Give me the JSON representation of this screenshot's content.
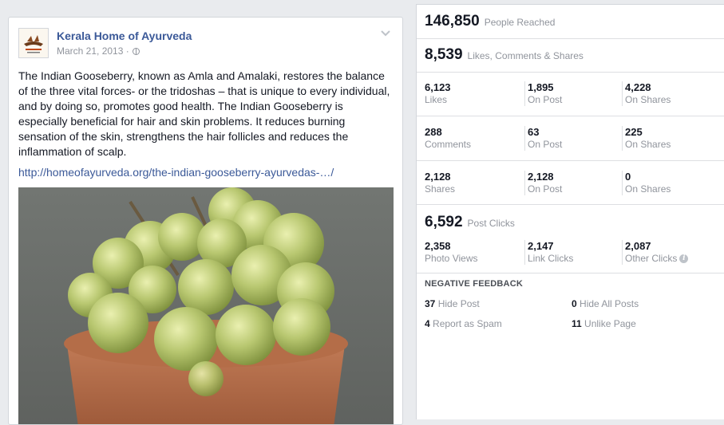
{
  "post": {
    "page_name": "Kerala Home of Ayurveda",
    "date": "March 21, 2013 ·",
    "text": "The Indian Gooseberry, known as Amla and Amalaki, restores the balance of the three vital forces- or the tridoshas – that is unique to every individual, and by doing so, promotes good health. The Indian Gooseberry is especially beneficial for hair and skin problems. It reduces burning sensation of the skin, strengthens the hair follicles and reduces the inflammation of scalp.",
    "link": "http://homeofayurveda.org/the-indian-gooseberry-ayurvedas-…/",
    "icons": {
      "menu": "chevron-down-icon",
      "privacy": "globe-icon"
    }
  },
  "insights": {
    "reach": {
      "value": "146,850",
      "label": "People Reached"
    },
    "engagement": {
      "value": "8,539",
      "label": "Likes, Comments & Shares"
    },
    "rows": [
      [
        {
          "value": "6,123",
          "label": "Likes"
        },
        {
          "value": "1,895",
          "label": "On Post"
        },
        {
          "value": "4,228",
          "label": "On Shares"
        }
      ],
      [
        {
          "value": "288",
          "label": "Comments"
        },
        {
          "value": "63",
          "label": "On Post"
        },
        {
          "value": "225",
          "label": "On Shares"
        }
      ],
      [
        {
          "value": "2,128",
          "label": "Shares"
        },
        {
          "value": "2,128",
          "label": "On Post"
        },
        {
          "value": "0",
          "label": "On Shares"
        }
      ]
    ],
    "clicks": {
      "value": "6,592",
      "label": "Post Clicks"
    },
    "click_cells": [
      {
        "value": "2,358",
        "label": "Photo Views"
      },
      {
        "value": "2,147",
        "label": "Link Clicks"
      },
      {
        "value": "2,087",
        "label": "Other Clicks"
      }
    ],
    "info_glyph": "i",
    "negative": {
      "title": "NEGATIVE FEEDBACK",
      "items": [
        {
          "value": "37",
          "label": "Hide Post"
        },
        {
          "value": "0",
          "label": "Hide All Posts"
        },
        {
          "value": "4",
          "label": "Report as Spam"
        },
        {
          "value": "11",
          "label": "Unlike Page"
        }
      ]
    }
  },
  "colors": {
    "link": "#3b5998",
    "muted": "#90949c",
    "border": "#dddfe2"
  }
}
